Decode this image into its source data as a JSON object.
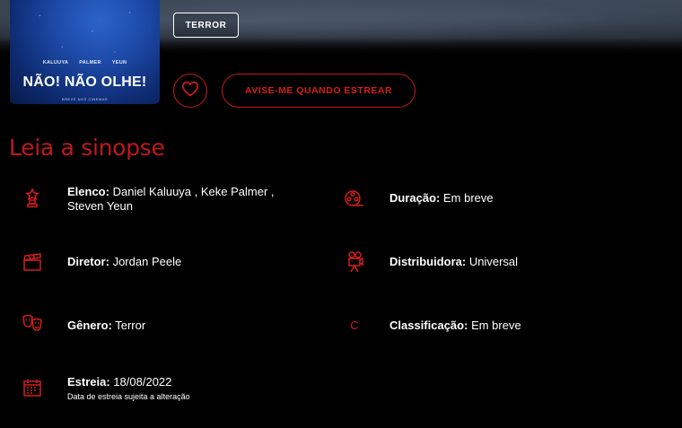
{
  "poster": {
    "cast": [
      "KALUUYA",
      "PALMER",
      "YEUN"
    ],
    "title": "NÃO! NÃO OLHE!",
    "tagline": "BREVE NOS CINEMAS"
  },
  "genre_tag": "TERROR",
  "actions": {
    "favorite_icon": "heart-icon",
    "notify_label": "AVISE-ME QUANDO ESTREAR"
  },
  "section_title": "Leia a sinopse",
  "colors": {
    "accent": "#d61d1d",
    "background": "#000000"
  },
  "info": {
    "cast": {
      "icon": "award-statue-icon",
      "label": "Elenco:",
      "value": "Daniel Kaluuya , Keke Palmer ,",
      "value2": "Steven Yeun"
    },
    "duration": {
      "icon": "film-reel-icon",
      "label": "Duração:",
      "value": "Em breve"
    },
    "director": {
      "icon": "clapperboard-icon",
      "label": "Diretor:",
      "value": "Jordan Peele"
    },
    "distributor": {
      "icon": "movie-camera-icon",
      "label": "Distribuidora:",
      "value": "Universal"
    },
    "genre": {
      "icon": "theater-masks-icon",
      "label": "Gênero:",
      "value": "Terror"
    },
    "rating": {
      "icon": "rating-c-icon",
      "glyph": "C",
      "label": "Classificação:",
      "value": "Em breve"
    },
    "release": {
      "icon": "calendar-icon",
      "label": "Estreia:",
      "value": "18/08/2022",
      "note": "Data de estreia sujeita a alteração"
    }
  }
}
